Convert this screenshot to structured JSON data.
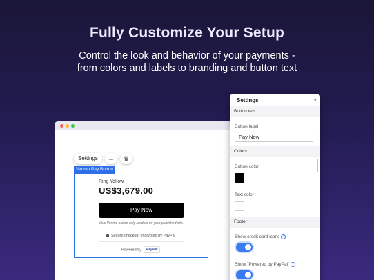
{
  "hero": {
    "title": "Fully Customize Your Setup",
    "subtitle_line1": "Control the look and behavior of your payments -",
    "subtitle_line2": "from colors and labels to branding and button text"
  },
  "editor": {
    "toolbar": {
      "settings_label": "Settings",
      "resize_icon": "↔",
      "crown_icon": "♛"
    },
    "widget_tag": "Venmo  Pay Button",
    "product": {
      "name": "Ring Yellow",
      "price": "US$3,679.00"
    },
    "pay_button_label": "Pay Now",
    "live_note": "Live Venmo button only renders on your published site.",
    "secure_text": "Secure checkout encrypted by PayPal",
    "powered_by": "Powered by",
    "paypal_logo_text": "PayPal"
  },
  "settings_panel": {
    "title": "Settings",
    "close_icon": "×",
    "sections": {
      "button_text": "Button text",
      "colors": "Colors",
      "footer": "Footer"
    },
    "button_label_label": "Button label",
    "button_label_value": "Pay Now",
    "button_color_label": "Button color",
    "button_color_value": "#000000",
    "text_color_label": "Text color",
    "text_color_value": "#ffffff",
    "show_card_icons_label": "Show credit card icons",
    "show_card_icons_on": true,
    "show_powered_label": "Show \"Powered by PayPal\"",
    "show_powered_on": true
  },
  "colors": {
    "accent": "#3b7bf1",
    "widget_border": "#2f6fe8"
  }
}
